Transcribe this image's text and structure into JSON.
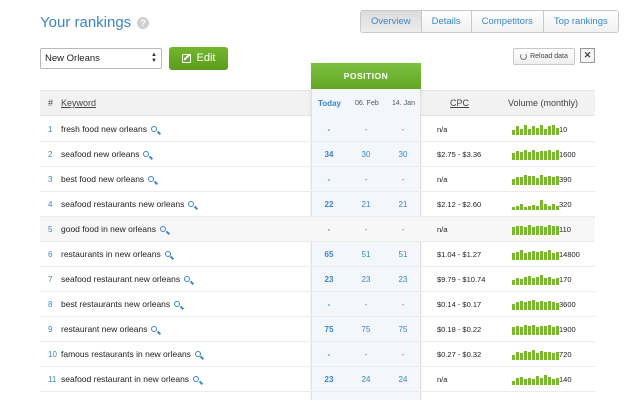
{
  "header": {
    "title": "Your rankings",
    "help_icon": "?"
  },
  "tabs": [
    {
      "label": "Overview",
      "active": true
    },
    {
      "label": "Details",
      "active": false
    },
    {
      "label": "Competitors",
      "active": false
    },
    {
      "label": "Top rankings",
      "active": false
    }
  ],
  "toolbar": {
    "location": "New Orleans",
    "edit_label": "Edit",
    "reload_label": "Reload data",
    "export_icon": "excel-icon"
  },
  "table": {
    "position_header": "POSITION",
    "columns": {
      "num": "#",
      "keyword": "Keyword",
      "today": "Today",
      "date1": "06. Feb",
      "date2": "14. Jan",
      "cpc": "CPC",
      "volume": "Volume (monthly)"
    },
    "rows": [
      {
        "num": "1",
        "keyword": "fresh food new orleans",
        "today": "-",
        "d1": "-",
        "d2": "-",
        "cpc": "n/a",
        "volume": "10",
        "bars": [
          0.45,
          0.8,
          0.55,
          0.9,
          0.5,
          0.85,
          0.6,
          0.9,
          0.55,
          0.8,
          0.95,
          0.65
        ]
      },
      {
        "num": "2",
        "keyword": "seafood new orleans",
        "today": "34",
        "d1": "30",
        "d2": "30",
        "cpc": "$2.75 - $3.36",
        "volume": "1600",
        "bars": [
          0.6,
          0.85,
          0.75,
          0.95,
          0.7,
          0.9,
          0.75,
          0.85,
          0.8,
          0.95,
          0.7,
          0.9
        ]
      },
      {
        "num": "3",
        "keyword": "best food new orleans",
        "today": "-",
        "d1": "-",
        "d2": "-",
        "cpc": "n/a",
        "volume": "390",
        "bars": [
          0.55,
          0.75,
          0.7,
          0.9,
          0.8,
          0.85,
          0.65,
          0.95,
          0.75,
          0.85,
          0.7,
          0.8
        ]
      },
      {
        "num": "4",
        "keyword": "seafood restaurants new orleans",
        "today": "22",
        "d1": "21",
        "d2": "21",
        "cpc": "$2.12 - $2.60",
        "volume": "320",
        "bars": [
          0.3,
          0.35,
          0.5,
          0.3,
          0.4,
          0.45,
          0.35,
          0.95,
          0.5,
          0.4,
          0.55,
          0.35
        ]
      },
      {
        "num": "5",
        "keyword": "good food in new orleans",
        "today": "-",
        "d1": "-",
        "d2": "-",
        "cpc": "n/a",
        "volume": "110",
        "bars": [
          0.7,
          0.8,
          0.85,
          0.75,
          0.9,
          0.7,
          0.85,
          0.8,
          0.75,
          0.9,
          0.8,
          0.85
        ]
      },
      {
        "num": "6",
        "keyword": "restaurants in new orleans",
        "today": "65",
        "d1": "51",
        "d2": "51",
        "cpc": "$1.04 - $1.27",
        "volume": "14800",
        "bars": [
          0.6,
          0.7,
          0.95,
          0.65,
          0.75,
          0.85,
          0.7,
          0.8,
          0.75,
          0.9,
          0.65,
          0.7
        ]
      },
      {
        "num": "7",
        "keyword": "seafood restaurant new orleans",
        "today": "23",
        "d1": "23",
        "d2": "23",
        "cpc": "$9.79 - $10.74",
        "volume": "170",
        "bars": [
          0.45,
          0.65,
          0.55,
          0.75,
          0.85,
          0.6,
          0.7,
          0.95,
          0.6,
          0.75,
          0.55,
          0.65
        ]
      },
      {
        "num": "8",
        "keyword": "best restaurants new orleans",
        "today": "-",
        "d1": "-",
        "d2": "-",
        "cpc": "$0.14 - $0.17",
        "volume": "3600",
        "bars": [
          0.55,
          0.75,
          0.85,
          0.7,
          0.8,
          0.95,
          0.75,
          0.85,
          0.7,
          0.8,
          0.75,
          0.65
        ]
      },
      {
        "num": "9",
        "keyword": "restaurant new orleans",
        "today": "75",
        "d1": "75",
        "d2": "75",
        "cpc": "$0.18 - $0.22",
        "volume": "1900",
        "bars": [
          0.7,
          0.85,
          0.75,
          0.9,
          0.8,
          0.95,
          0.75,
          0.85,
          0.8,
          0.9,
          0.7,
          0.8
        ]
      },
      {
        "num": "10",
        "keyword": "famous restaurants in new orleans",
        "today": "-",
        "d1": "-",
        "d2": "-",
        "cpc": "$0.27 - $0.32",
        "volume": "720",
        "bars": [
          0.45,
          0.7,
          0.6,
          0.85,
          0.7,
          0.95,
          0.65,
          0.8,
          0.75,
          0.7,
          0.6,
          0.75
        ]
      },
      {
        "num": "11",
        "keyword": "seafood restaurant in new orleans",
        "today": "23",
        "d1": "24",
        "d2": "24",
        "cpc": "n/a",
        "volume": "140",
        "bars": [
          0.35,
          0.6,
          0.75,
          0.5,
          0.65,
          0.55,
          0.8,
          0.6,
          0.95,
          0.7,
          0.5,
          0.6
        ]
      }
    ]
  },
  "colors": {
    "accent_blue": "#3a86c8",
    "accent_green": "#6aaf28",
    "bar_green": "#7cb82f"
  }
}
